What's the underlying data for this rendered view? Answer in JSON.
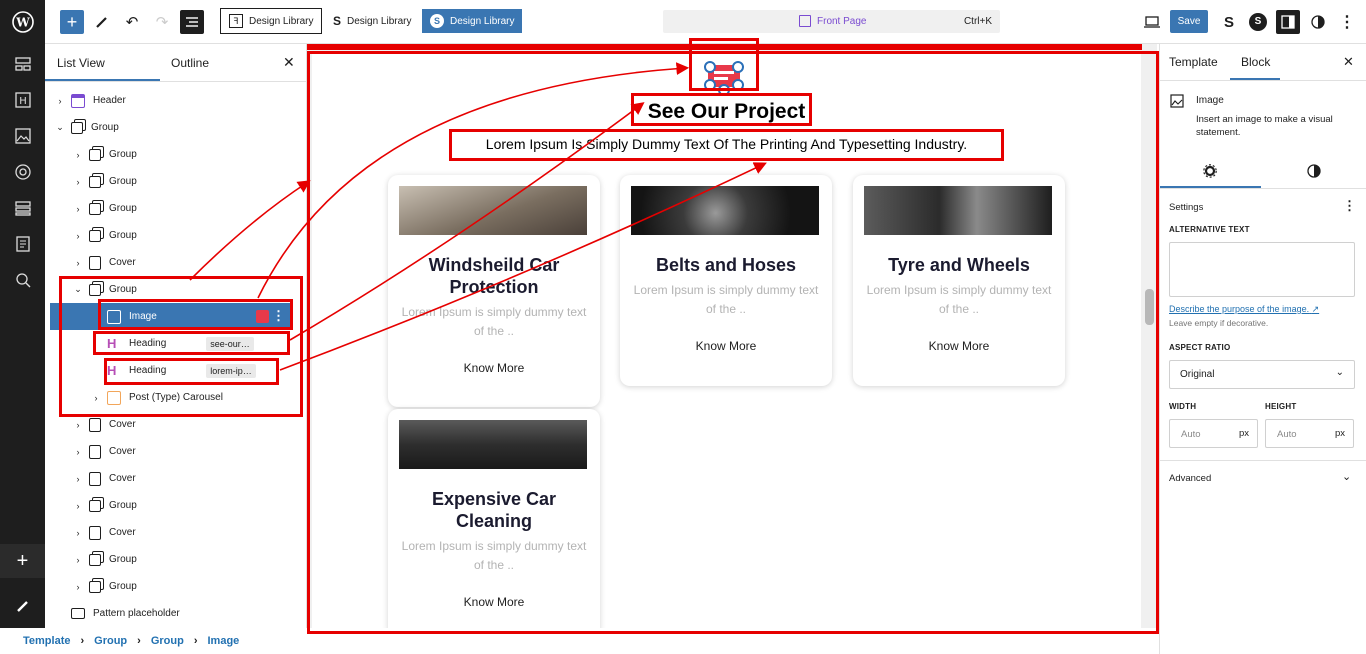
{
  "topbar": {
    "pill1": "Design Library",
    "pill2": "Design Library",
    "pill3": "Design Library",
    "command_title": "Front Page",
    "command_shortcut": "Ctrl+K",
    "save_label": "Save",
    "icons": [
      "wordpress-logo",
      "plus-icon",
      "pen-icon",
      "undo-icon",
      "redo-icon",
      "list-view-icon"
    ]
  },
  "list_view": {
    "tabs": [
      "List View",
      "Outline"
    ],
    "rows": [
      {
        "label": "Header",
        "level": 0,
        "expanded": false,
        "icon": "header"
      },
      {
        "label": "Group",
        "level": 0,
        "expanded": true,
        "icon": "group"
      },
      {
        "label": "Group",
        "level": 1,
        "expanded": false,
        "icon": "group"
      },
      {
        "label": "Group",
        "level": 1,
        "expanded": false,
        "icon": "group"
      },
      {
        "label": "Group",
        "level": 1,
        "expanded": false,
        "icon": "group"
      },
      {
        "label": "Group",
        "level": 1,
        "expanded": false,
        "icon": "group"
      },
      {
        "label": "Cover",
        "level": 1,
        "expanded": false,
        "icon": "cover"
      },
      {
        "label": "Group",
        "level": 1,
        "expanded": true,
        "icon": "group"
      },
      {
        "label": "Image",
        "level": 2,
        "selected": true,
        "icon": "image"
      },
      {
        "label": "Heading",
        "level": 2,
        "tag": "see-our…",
        "icon": "heading"
      },
      {
        "label": "Heading",
        "level": 2,
        "tag": "lorem-ip…",
        "icon": "heading"
      },
      {
        "label": "Post (Type) Carousel",
        "level": 2,
        "expanded": false,
        "icon": "carousel"
      },
      {
        "label": "Cover",
        "level": 1,
        "expanded": false,
        "icon": "cover"
      },
      {
        "label": "Cover",
        "level": 1,
        "expanded": false,
        "icon": "cover"
      },
      {
        "label": "Cover",
        "level": 1,
        "expanded": false,
        "icon": "cover"
      },
      {
        "label": "Group",
        "level": 1,
        "expanded": false,
        "icon": "group"
      },
      {
        "label": "Cover",
        "level": 1,
        "expanded": false,
        "icon": "cover"
      },
      {
        "label": "Group",
        "level": 1,
        "expanded": false,
        "icon": "group"
      },
      {
        "label": "Group",
        "level": 1,
        "expanded": false,
        "icon": "group"
      },
      {
        "label": "Pattern placeholder",
        "level": 0,
        "expanded": false,
        "icon": "pattern"
      }
    ]
  },
  "canvas": {
    "heading": "See Our Project",
    "subheading": "Lorem Ipsum Is Simply Dummy Text Of The Printing And Typesetting Industry.",
    "cards": [
      {
        "title": "Windsheild Car Protection",
        "text": "Lorem Ipsum is simply dummy text of the ..",
        "link": "Know More",
        "photo_color": "#8a7f74"
      },
      {
        "title": "Belts and Hoses",
        "text": "Lorem Ipsum is simply dummy text of the ..",
        "link": "Know More",
        "photo_color": "#2b2b2b"
      },
      {
        "title": "Tyre and Wheels",
        "text": "Lorem Ipsum is simply dummy text of the ..",
        "link": "Know More",
        "photo_color": "#4c4c4c"
      },
      {
        "title": "Expensive Car Cleaning",
        "text": "Lorem Ipsum is simply dummy text of the ..",
        "link": "Know More",
        "photo_color": "#3a3a3a"
      }
    ]
  },
  "settings": {
    "tabs": [
      "Template",
      "Block"
    ],
    "block_name": "Image",
    "block_desc": "Insert an image to make a visual statement.",
    "section": "Settings",
    "alt_label": "ALTERNATIVE TEXT",
    "alt_link": "Describe the purpose of the image.",
    "alt_help": "Leave empty if decorative.",
    "aspect_label": "ASPECT RATIO",
    "aspect_value": "Original",
    "width_label": "WIDTH",
    "height_label": "HEIGHT",
    "auto": "Auto",
    "unit": "px",
    "advanced": "Advanced"
  },
  "breadcrumb": [
    "Template",
    "Group",
    "Group",
    "Image"
  ],
  "colors": {
    "accent": "#3a76b2",
    "wp_blue": "#2271b1",
    "annotation_red": "#e60000"
  }
}
